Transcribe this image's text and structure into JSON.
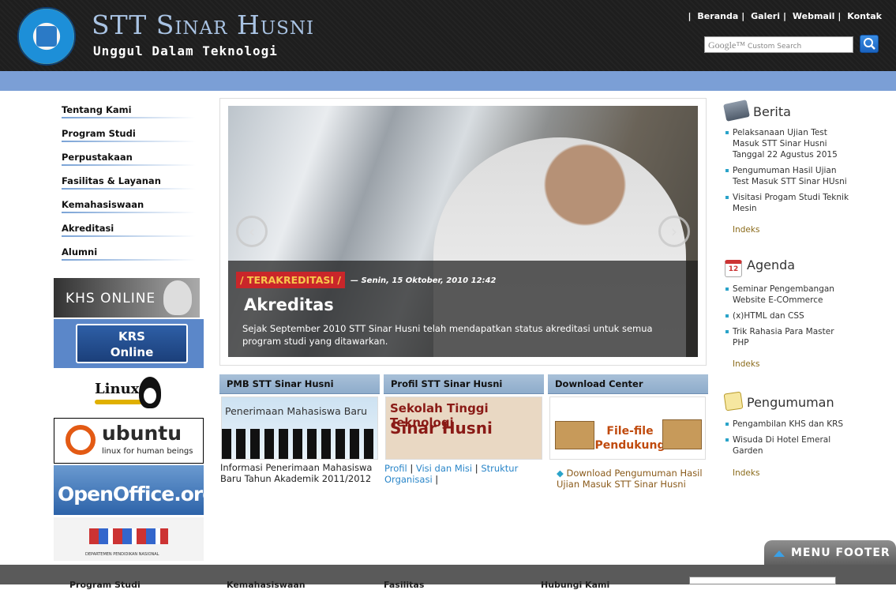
{
  "header": {
    "title": "STT Sinar Husni",
    "tagline": "Unggul Dalam Teknologi",
    "nav": [
      "Beranda",
      "Galeri",
      "Webmail",
      "Kontak"
    ],
    "search_brand": "Google™",
    "search_placeholder": "Custom Search"
  },
  "left_nav": {
    "items": [
      "Tentang Kami",
      "Program Studi",
      "Perpustakaan",
      "Fasilitas & Layanan",
      "Kemahasiswaan",
      "Akreditasi",
      "Alumni"
    ]
  },
  "banners": {
    "khs": "KHS ONLINE",
    "krs_line1": "KRS",
    "krs_line2": "Online",
    "linux": "Linux",
    "ubuntu": "ubuntu",
    "ubuntu_sub": "linux for human beings",
    "openoffice": "OpenOffice.org",
    "dikbud": "DEPARTEMEN PENDIDIKAN NASIONAL"
  },
  "slider": {
    "category": "/ TERAKREDITASI /",
    "date": "— Senin, 15 Oktober, 2010 12:42",
    "title": "Akreditas",
    "text": "Sejak September 2010 STT Sinar Husni telah mendapatkan status akreditasi untuk semua program studi yang ditawarkan.",
    "prev": "‹",
    "next": "›"
  },
  "boxes": {
    "pmb": {
      "head": "PMB STT Sinar Husni",
      "img_text": "Penerimaan Mahasiswa Baru",
      "text": "Informasi Penerimaan Mahasiswa Baru Tahun Akademik 2011/2012"
    },
    "profil": {
      "head": "Profil STT Sinar Husni",
      "img_line1": "Sekolah Tinggi Teknologi",
      "img_line2": "Sinar Husni",
      "links": [
        "Profil",
        "Visi dan Misi",
        "Struktur Organisasi"
      ]
    },
    "download": {
      "head": "Download Center",
      "img_text": "File-file Pendukung",
      "link": "Download Pengumuman Hasil Ujian Masuk STT Sinar Husni"
    }
  },
  "sidebar": {
    "berita": {
      "title": "Berita",
      "items": [
        "Pelaksanaan Ujian Test Masuk STT Sinar Husni Tanggal 22 Agustus 2015",
        "Pengumuman Hasil Ujian Test Masuk STT Sinar HUsni",
        "Visitasi Progam Studi Teknik Mesin"
      ],
      "more": "Indeks"
    },
    "agenda": {
      "title": "Agenda",
      "icon_label": "12",
      "items": [
        "Seminar Pengembangan Website E-COmmerce",
        "(x)HTML dan CSS",
        "Trik Rahasia Para Master PHP"
      ],
      "more": "Indeks"
    },
    "pengumuman": {
      "title": "Pengumuman",
      "items": [
        "Pengambilan KHS dan KRS",
        "Wisuda Di Hotel Emeral Garden"
      ],
      "more": "Indeks"
    }
  },
  "footer": {
    "tab_label": "MENU FOOTER",
    "columns": [
      "Program Studi",
      "Kemahasiswaan",
      "Fasilitas",
      "Hubungi Kami"
    ]
  },
  "colors": {
    "header_bg": "#1e1e1e",
    "accent_bar": "#7b9fd6",
    "badge_red": "#c9262a",
    "link_blue": "#2a86c9",
    "indeks_gold": "#8a6a1a"
  },
  "icons": {
    "search": "magnifier-icon",
    "berita": "newspaper-icon",
    "agenda": "calendar-icon",
    "pengumuman": "notepad-icon"
  }
}
